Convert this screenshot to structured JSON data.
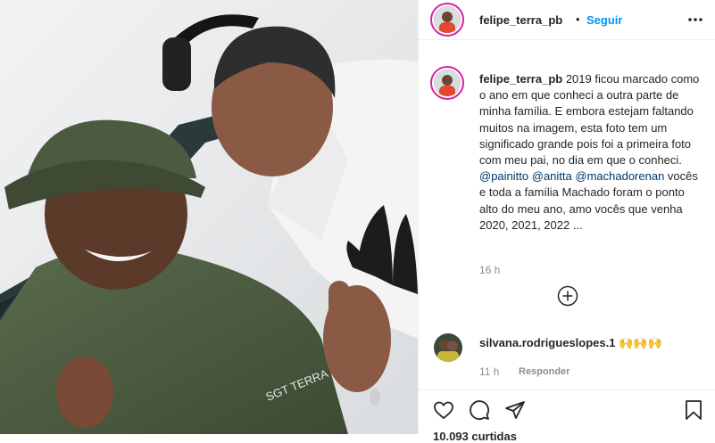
{
  "post": {
    "username": "felipe_terra_pb",
    "follow_label": "Seguir",
    "separator": "•",
    "caption_text": "2019 ficou marcado como o ano em que conheci a outra parte de minha família. E embora estejam faltando muitos na imagem, esta foto tem um significado grande pois foi a primeira foto com meu pai, no dia em que o conheci. ",
    "mentions": [
      "@painitto",
      "@anitta",
      "@machadorenan"
    ],
    "caption_tail": " vocês e toda a família Machado foram o ponto alto do meu ano, amo vocês que venha 2020, 2021, 2022 ...",
    "caption_time": "16 h",
    "photo_text": "SGT TERRA"
  },
  "comment": {
    "username": "silvana.rodrigueslopes.1",
    "emojis": "🙌🙌🙌",
    "time": "11 h",
    "reply_label": "Responder"
  },
  "footer": {
    "likes_text": "10.093 curtidas"
  },
  "icons": {
    "more": "more-options-icon",
    "add": "add-comment-icon",
    "like": "heart-icon",
    "comment": "comment-icon",
    "share": "share-icon",
    "save": "bookmark-icon"
  },
  "colors": {
    "link": "#0095f6",
    "mention": "#00376b",
    "muted": "#8e8e8e",
    "text": "#262626",
    "story_ring": "#d6249f"
  }
}
